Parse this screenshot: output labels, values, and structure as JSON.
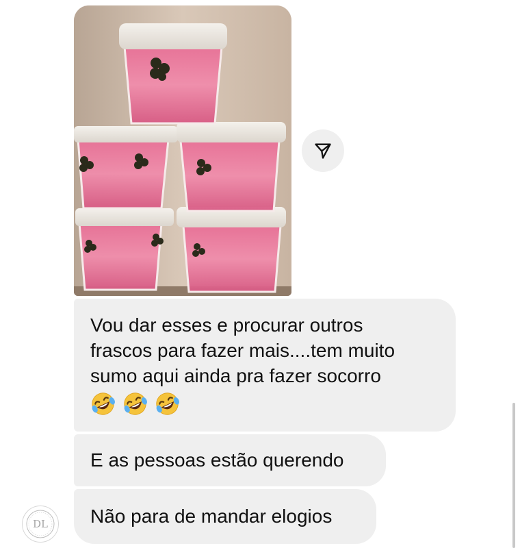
{
  "messages": [
    {
      "type": "image",
      "description_icon": "photo-message"
    },
    {
      "type": "text",
      "lines": [
        "Vou dar esses e procurar outros",
        "frascos para fazer mais....tem muito",
        "sumo aqui ainda pra fazer socorro"
      ],
      "emojis": [
        "rolling-on-floor-laughing-emoji",
        "rolling-on-floor-laughing-emoji",
        "rolling-on-floor-laughing-emoji"
      ]
    },
    {
      "type": "text",
      "text": "E as pessoas estão querendo"
    },
    {
      "type": "text",
      "text": "Não para de mandar elogios"
    }
  ],
  "avatar": {
    "initials": "DL"
  },
  "share_button": {
    "icon": "send-icon"
  },
  "colors": {
    "bubble_bg": "#efefef",
    "text": "#111111",
    "background": "#ffffff",
    "share_button_bg": "#efefef"
  }
}
